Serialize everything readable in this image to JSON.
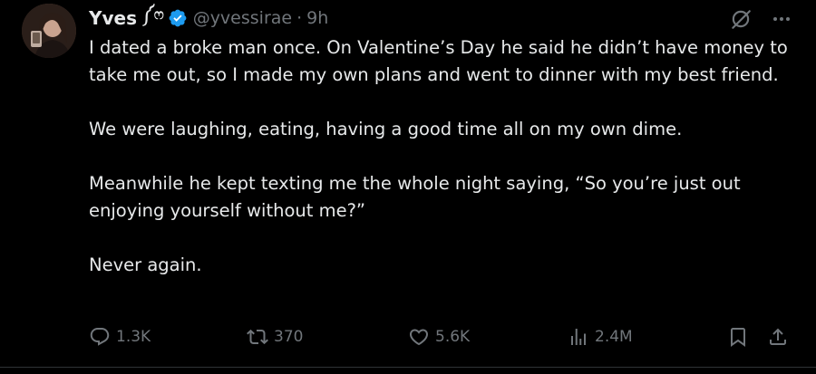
{
  "author": {
    "display_name": "Yves",
    "name_emoji": "༼ෆ",
    "verified": true,
    "handle": "@yvessirae",
    "separator": "·",
    "time": "9h",
    "avatar_icon": "profile-photo"
  },
  "top_actions": {
    "grok_icon": "grok-icon",
    "more_icon": "more-icon"
  },
  "body": {
    "paragraphs": [
      "I dated a broke man once. On Valentine’s Day he said he didn’t have money to take me out, so I made my own plans and went to dinner with my best friend.",
      "We were laughing, eating, having a good time all on my own dime.",
      "Meanwhile he kept texting me the whole night saying, “So you’re just out enjoying yourself without me?”",
      "Never again."
    ]
  },
  "metrics": {
    "replies": "1.3K",
    "retweets": "370",
    "likes": "5.6K",
    "views": "2.4M"
  },
  "colors": {
    "background": "#000000",
    "text": "#e7e9ea",
    "muted": "#71767b",
    "verified": "#1d9bf0",
    "divider": "#2f3336"
  }
}
